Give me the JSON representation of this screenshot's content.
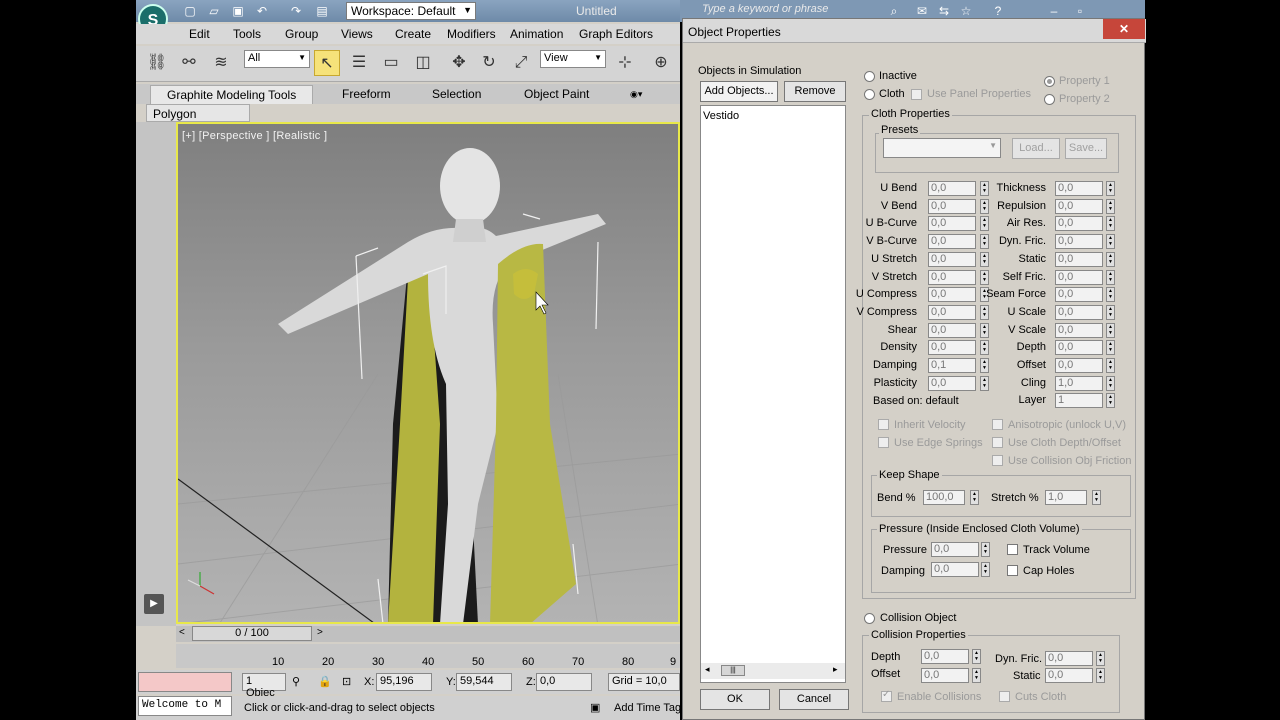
{
  "app": {
    "title": "Untitled",
    "workspace": "Workspace: Default",
    "menu": [
      "Edit",
      "Tools",
      "Group",
      "Views",
      "Create",
      "Modifiers",
      "Animation",
      "Graph Editors"
    ],
    "selection_filter": "All",
    "ref_coord": "View",
    "ribbon_tabs": [
      "Graphite Modeling Tools",
      "Freeform",
      "Selection",
      "Object Paint"
    ],
    "ribbon_panel": "Polygon Modeling",
    "viewport_label": "[+] [Perspective ] [Realistic ]",
    "time_slider": "0 / 100",
    "timeline_ticks": [
      "10",
      "20",
      "30",
      "40",
      "50",
      "60",
      "70",
      "80",
      "9"
    ],
    "status": {
      "selected": "1 Objec",
      "x_label": "X:",
      "x_value": "95,196",
      "y_label": "Y:",
      "y_value": "59,544",
      "z_label": "Z:",
      "z_value": "0,0",
      "grid": "Grid = 10,0",
      "welcome": "Welcome to M",
      "prompt": "Click or click-and-drag to select objects",
      "add_time_tag": "Add Time Tag"
    },
    "search_placeholder": "Type a keyword or phrase"
  },
  "dialog": {
    "title": "Object Properties",
    "close": "✕",
    "objects_label": "Objects in Simulation",
    "add_objects": "Add Objects...",
    "remove": "Remove",
    "objects": [
      "Vestido"
    ],
    "inactive": "Inactive",
    "cloth": "Cloth",
    "use_panel_properties": "Use Panel Properties",
    "property1": "Property 1",
    "property2": "Property 2",
    "cloth_properties": "Cloth Properties",
    "presets": "Presets",
    "load": "Load...",
    "save": "Save...",
    "left_props": [
      {
        "label": "U Bend",
        "value": "0,0"
      },
      {
        "label": "V Bend",
        "value": "0,0"
      },
      {
        "label": "U B-Curve",
        "value": "0,0"
      },
      {
        "label": "V B-Curve",
        "value": "0,0"
      },
      {
        "label": "U Stretch",
        "value": "0,0"
      },
      {
        "label": "V Stretch",
        "value": "0,0"
      },
      {
        "label": "U Compress",
        "value": "0,0"
      },
      {
        "label": "V Compress",
        "value": "0,0"
      },
      {
        "label": "Shear",
        "value": "0,0"
      },
      {
        "label": "Density",
        "value": "0,0"
      },
      {
        "label": "Damping",
        "value": "0,1"
      },
      {
        "label": "Plasticity",
        "value": "0,0"
      }
    ],
    "right_props": [
      {
        "label": "Thickness",
        "value": "0,0"
      },
      {
        "label": "Repulsion",
        "value": "0,0"
      },
      {
        "label": "Air Res.",
        "value": "0,0"
      },
      {
        "label": "Dyn. Fric.",
        "value": "0,0"
      },
      {
        "label": "Static",
        "value": "0,0"
      },
      {
        "label": "Self Fric.",
        "value": "0,0"
      },
      {
        "label": "Seam Force",
        "value": "0,0"
      },
      {
        "label": "U Scale",
        "value": "0,0"
      },
      {
        "label": "V Scale",
        "value": "0,0"
      },
      {
        "label": "Depth",
        "value": "0,0"
      },
      {
        "label": "Offset",
        "value": "0,0"
      },
      {
        "label": "Cling",
        "value": "1,0"
      },
      {
        "label": "Layer",
        "value": "1"
      }
    ],
    "based_on": "Based on: default",
    "inherit_velocity": "Inherit Velocity",
    "use_edge_springs": "Use Edge Springs",
    "anisotropic": "Anisotropic (unlock U,V)",
    "use_cloth_depth": "Use Cloth Depth/Offset",
    "use_collision_friction": "Use Collision Obj Friction",
    "keep_shape": "Keep Shape",
    "bend_pct_label": "Bend %",
    "bend_pct": "100,0",
    "stretch_pct_label": "Stretch %",
    "stretch_pct": "1,0",
    "pressure_group": "Pressure (Inside Enclosed Cloth Volume)",
    "pressure_label": "Pressure",
    "pressure": "0,0",
    "damping_label": "Damping",
    "damping": "0,0",
    "track_volume": "Track Volume",
    "cap_holes": "Cap Holes",
    "collision_object": "Collision Object",
    "collision_properties": "Collision Properties",
    "col_depth_label": "Depth",
    "col_depth": "0,0",
    "col_offset_label": "Offset",
    "col_offset": "0,0",
    "col_dyn_fric_label": "Dyn. Fric.",
    "col_dyn_fric": "0,0",
    "col_static_label": "Static",
    "col_static": "0,0",
    "enable_collisions": "Enable Collisions",
    "cuts_cloth": "Cuts Cloth",
    "ok": "OK",
    "cancel": "Cancel"
  }
}
